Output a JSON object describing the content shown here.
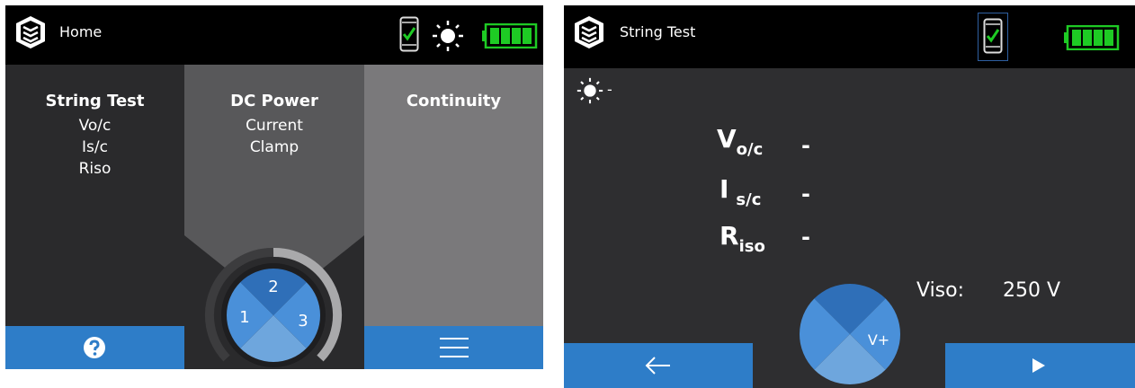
{
  "home": {
    "title": "Home",
    "columns": [
      {
        "title": "String Test",
        "lines": [
          "Vo/c",
          "Is/c",
          "Riso"
        ]
      },
      {
        "title": "DC Power",
        "lines": [
          "Current",
          "Clamp"
        ]
      },
      {
        "title": "Continuity",
        "lines": []
      }
    ],
    "dial": {
      "segments": [
        "2",
        "1",
        "3"
      ]
    },
    "bottom": {
      "left_icon": "help-icon",
      "right_icon": "menu-icon"
    },
    "icons": {
      "phone": "phone-check-icon",
      "sun": "sun-icon",
      "battery": "battery-icon"
    },
    "battery_level": 1.0
  },
  "string_test": {
    "title": "String Test",
    "sun_value": "-",
    "measurements": [
      {
        "main": "V",
        "sub": "o/c",
        "value": "-"
      },
      {
        "main": "I",
        "sub": "s/c",
        "value": "-"
      },
      {
        "main": "R",
        "sub": "iso",
        "value": "-"
      }
    ],
    "viso_label": "Viso:",
    "viso_value": "250 V",
    "dial_label": "V+",
    "bottom": {
      "left_icon": "back-arrow-icon",
      "right_icon": "play-icon"
    },
    "battery_level": 1.0
  },
  "colors": {
    "accent": "#2e7dc8",
    "dial_light": "#4a90d9",
    "dial_dark": "#2f6fb8",
    "battery": "#1ecb24",
    "check": "#1ecb24"
  }
}
